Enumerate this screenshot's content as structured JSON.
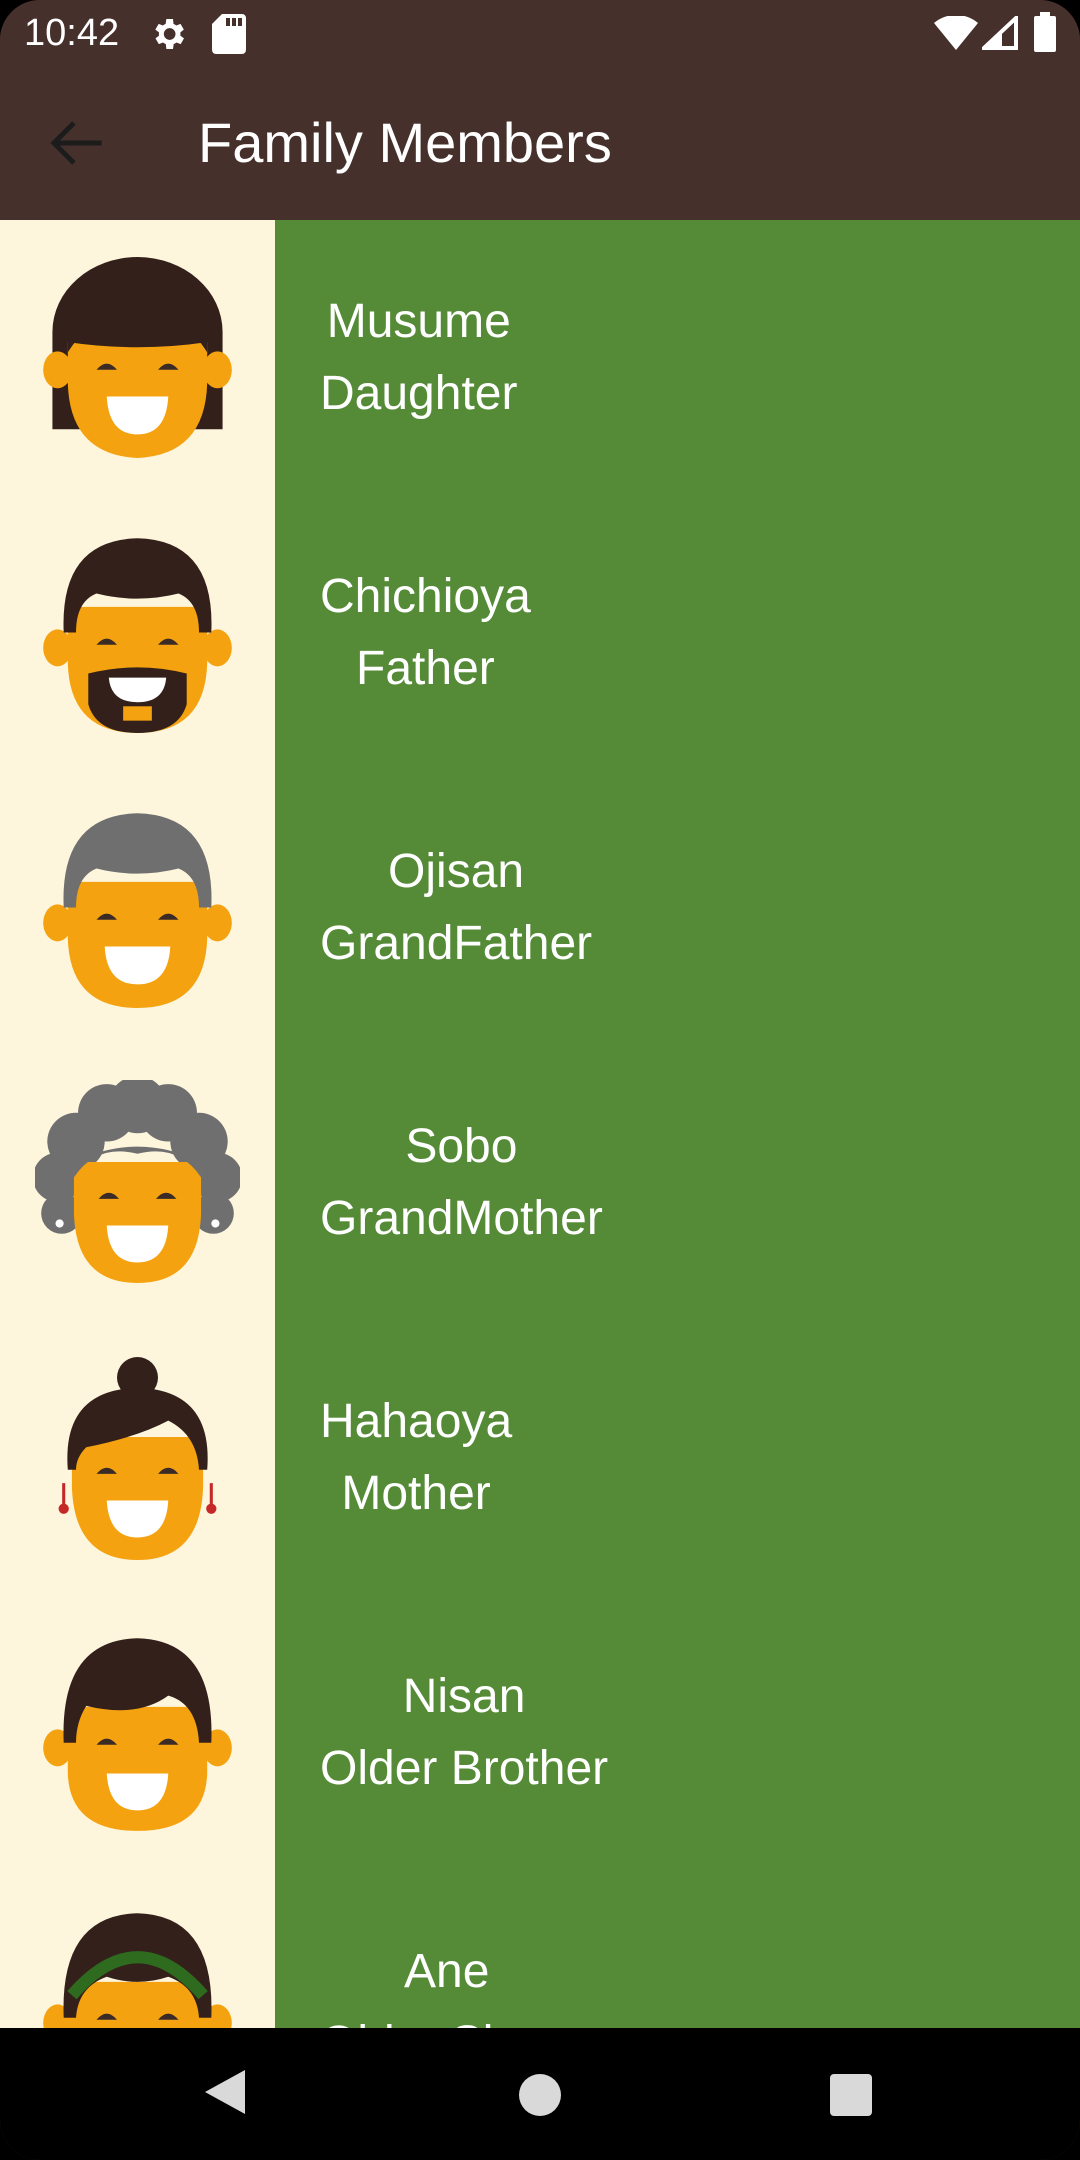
{
  "status_bar": {
    "time": "10:42",
    "icons": [
      "settings-icon",
      "sd-card-icon",
      "wifi-icon",
      "cell-signal-icon",
      "battery-icon"
    ]
  },
  "app_bar": {
    "title": "Family Members",
    "back_icon": "arrow-back-icon"
  },
  "colors": {
    "app_bar": "#46302b",
    "row_background": "#558b37",
    "avatar_background": "#fdf5dc",
    "text": "#ffffff"
  },
  "members": [
    {
      "japanese": "Musume",
      "english": "Daughter",
      "avatar": "daughter-avatar-icon"
    },
    {
      "japanese": "Chichioya",
      "english": "Father",
      "avatar": "father-avatar-icon"
    },
    {
      "japanese": "Ojisan",
      "english": "GrandFather",
      "avatar": "grandfather-avatar-icon"
    },
    {
      "japanese": "Sobo",
      "english": "GrandMother",
      "avatar": "grandmother-avatar-icon"
    },
    {
      "japanese": "Hahaoya",
      "english": "Mother",
      "avatar": "mother-avatar-icon"
    },
    {
      "japanese": "Nisan",
      "english": "Older Brother",
      "avatar": "older-brother-avatar-icon"
    },
    {
      "japanese": "Ane",
      "english": "Older Sister",
      "avatar": "older-sister-avatar-icon"
    }
  ],
  "nav_bar": {
    "icons": [
      "nav-back-icon",
      "nav-home-icon",
      "nav-recents-icon"
    ]
  }
}
